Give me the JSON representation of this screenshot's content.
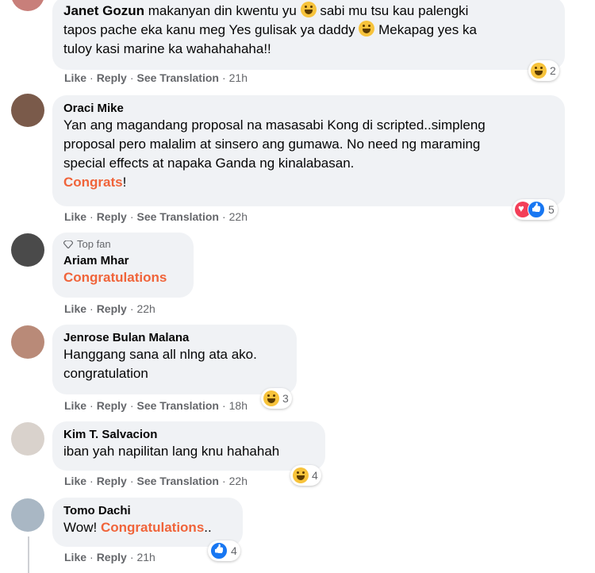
{
  "actions": {
    "like": "Like",
    "reply": "Reply",
    "see_translation": "See Translation",
    "sep": "·"
  },
  "comments": [
    {
      "name": "Janet Gozun",
      "lines": [
        "makanyan din kwentu yu",
        "sabi mu tsu kau palengki",
        "tapos pache eka kanu meg Yes gulisak ya daddy",
        "Mekapag yes ka",
        "tuloy kasi marine ka wahahahaha!!"
      ],
      "time": "21h",
      "reactions": [
        "haha"
      ],
      "reaction_count": "2",
      "has_translation": true
    },
    {
      "name": "Oraci Mike",
      "lines": [
        "Yan ang magandang proposal na masasabi Kong di scripted..simpleng",
        "proposal pero malalim at sinsero ang gumawa. No need ng maraming",
        "special effects at napaka Ganda ng kinalabasan."
      ],
      "highlight": "Congrats",
      "highlight_suffix": "!",
      "time": "22h",
      "reactions": [
        "love",
        "like"
      ],
      "reaction_count": "5",
      "has_translation": true
    },
    {
      "badge": "Top fan",
      "name": "Ariam Mhar",
      "highlight": "Congratulations",
      "time": "22h",
      "has_translation": false
    },
    {
      "name": "Jenrose Bulan Malana",
      "lines": [
        "Hanggang sana all nlng ata ako.",
        "congratulation"
      ],
      "time": "18h",
      "reactions": [
        "haha"
      ],
      "reaction_count": "3",
      "has_translation": true
    },
    {
      "name": "Kim T. Salvacion",
      "lines": [
        "iban yah napilitan lang knu hahahah"
      ],
      "time": "22h",
      "reactions": [
        "haha"
      ],
      "reaction_count": "4",
      "has_translation": true
    },
    {
      "name": "Tomo Dachi",
      "prefix": "Wow!",
      "highlight": "Congratulations",
      "highlight_suffix": "..",
      "time": "21h",
      "reactions": [
        "like"
      ],
      "reaction_count": "4",
      "has_translation": false
    }
  ],
  "colors": {
    "highlight": "#f0643a",
    "bubble": "#f0f2f5",
    "meta": "#65676b"
  }
}
